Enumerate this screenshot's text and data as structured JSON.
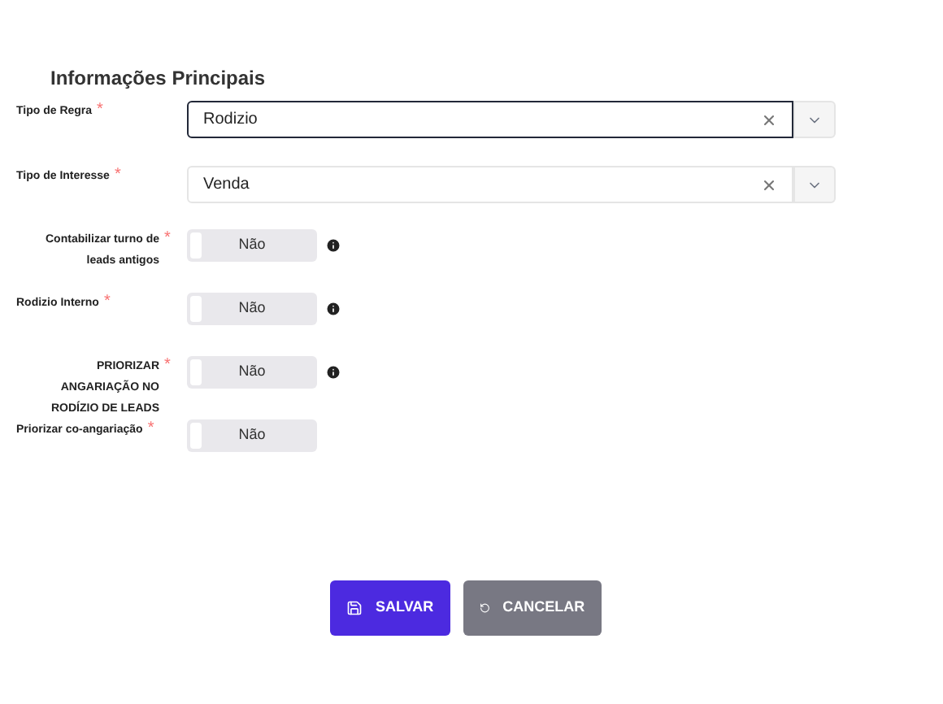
{
  "section_title": "Informações Principais",
  "selects": [
    {
      "label": "Tipo de Regra",
      "mark": "*",
      "value": "Rodizio",
      "focused": true
    },
    {
      "label": "Tipo de Interesse",
      "mark": "*",
      "value": "Venda",
      "focused": false
    }
  ],
  "toggles": [
    {
      "label": "Contabilizar turno de leads antigos",
      "mark": "*",
      "text": "Não",
      "on": false,
      "info": true
    },
    {
      "label": "Rodizio Interno",
      "mark": "*",
      "text": "Não",
      "on": false,
      "info": true
    },
    {
      "label": "PRIORIZAR ANGARIAÇÃO NO RODÍZIO DE LEADS",
      "mark": "*",
      "text": "Não",
      "on": false,
      "info": true
    },
    {
      "label": "Priorizar co-angariação",
      "mark": "*",
      "text": "Não",
      "on": false,
      "info": false
    }
  ],
  "buttons": [
    {
      "kind": "primary",
      "label": "SALVAR"
    },
    {
      "kind": "secondary",
      "label": "CANCELAR"
    }
  ]
}
